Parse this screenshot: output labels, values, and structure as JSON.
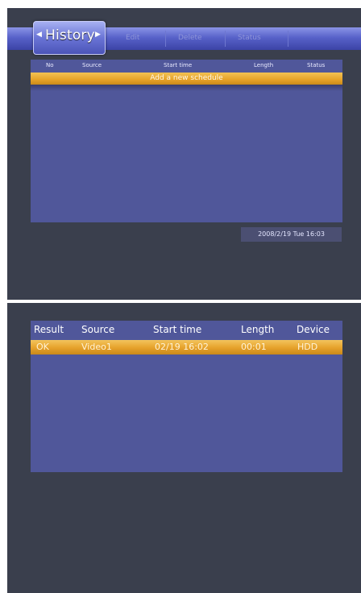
{
  "schedule_screen": {
    "active_tab": "History",
    "menu_items": [
      "Edit",
      "Delete",
      "Status"
    ],
    "table_headers": [
      "No",
      "Source",
      "Start time",
      "Length",
      "Status"
    ],
    "add_row_label": "Add a new schedule",
    "datetime": "2008/2/19 Tue 16:03"
  },
  "history_screen": {
    "table_headers": [
      "Result",
      "Source",
      "Start time",
      "Length",
      "Device"
    ],
    "rows": [
      {
        "result": "OK",
        "source": "Video1",
        "start_time": "02/19 16:02",
        "length": "00:01",
        "device": "HDD"
      }
    ]
  },
  "colors": {
    "screen_bg": "#3a3f4d",
    "panel_bg": "#50579a",
    "highlight": "#e6a228",
    "tabbar": "#5862c9"
  }
}
